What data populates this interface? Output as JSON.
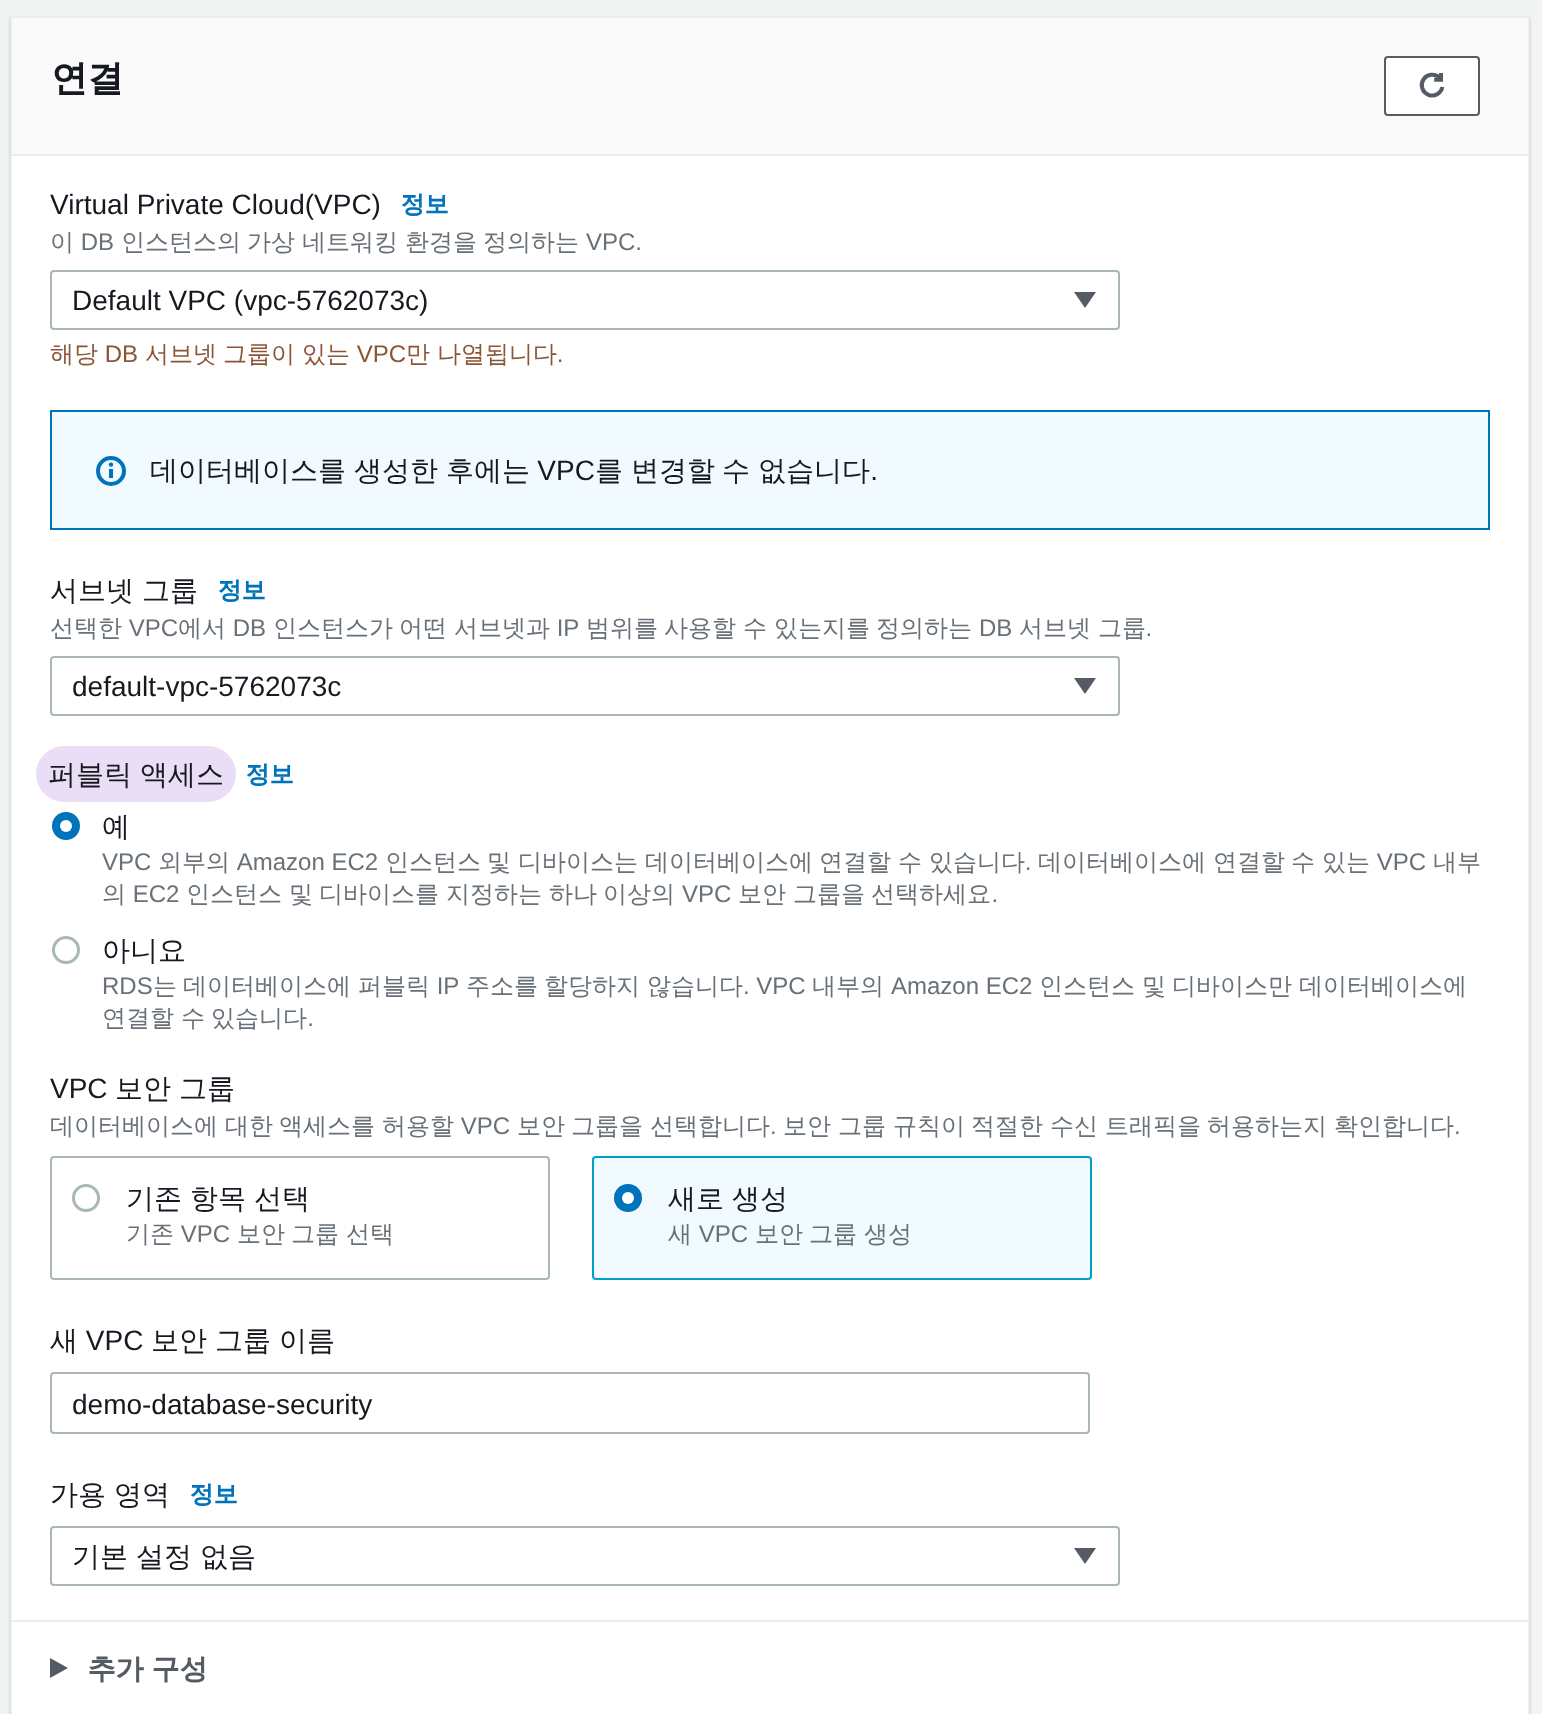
{
  "panel": {
    "title": "연결"
  },
  "fields": [
    {
      "kind": "select",
      "label": "Virtual Private Cloud(VPC)",
      "info": "정보",
      "description": "이 DB 인스턴스의 가상 네트워킹 환경을 정의하는 VPC.",
      "value": "Default VPC (vpc-5762073c)",
      "hint": "해당 DB 서브넷 그룹이 있는 VPC만 나열됩니다."
    },
    {
      "kind": "alert",
      "text": "데이터베이스를 생성한 후에는 VPC를 변경할 수 없습니다."
    },
    {
      "kind": "select",
      "label": "서브넷 그룹",
      "info": "정보",
      "description": "선택한 VPC에서 DB 인스턴스가 어떤 서브넷과 IP 범위를 사용할 수 있는지를 정의하는 DB 서브넷 그룹.",
      "value": "default-vpc-5762073c"
    },
    {
      "kind": "radio",
      "label": "퍼블릭 액세스",
      "highlighted": true,
      "info": "정보",
      "options": [
        {
          "label": "예",
          "description": "VPC 외부의 Amazon EC2 인스턴스 및 디바이스는 데이터베이스에 연결할 수 있습니다. 데이터베이스에 연결할 수 있는 VPC 내부의 EC2 인스턴스 및 디바이스를 지정하는 하나 이상의 VPC 보안 그룹을 선택하세요.",
          "selected": true
        },
        {
          "label": "아니요",
          "description": "RDS는 데이터베이스에 퍼블릭 IP 주소를 할당하지 않습니다. VPC 내부의 Amazon EC2 인스턴스 및 디바이스만 데이터베이스에 연결할 수 있습니다.",
          "selected": false
        }
      ]
    },
    {
      "kind": "tiles",
      "label": "VPC 보안 그룹",
      "description": "데이터베이스에 대한 액세스를 허용할 VPC 보안 그룹을 선택합니다. 보안 그룹 규칙이 적절한 수신 트래픽을 허용하는지 확인합니다.",
      "options": [
        {
          "label": "기존 항목 선택",
          "description": "기존 VPC 보안 그룹 선택",
          "selected": false
        },
        {
          "label": "새로 생성",
          "description": "새 VPC 보안 그룹 생성",
          "selected": true
        }
      ]
    },
    {
      "kind": "input",
      "label": "새 VPC 보안 그룹 이름",
      "value": "demo-database-security"
    },
    {
      "kind": "select",
      "label": "가용 영역",
      "info": "정보",
      "value": "기본 설정 없음"
    }
  ],
  "expander": {
    "label": "추가 구성",
    "expanded": false
  }
}
